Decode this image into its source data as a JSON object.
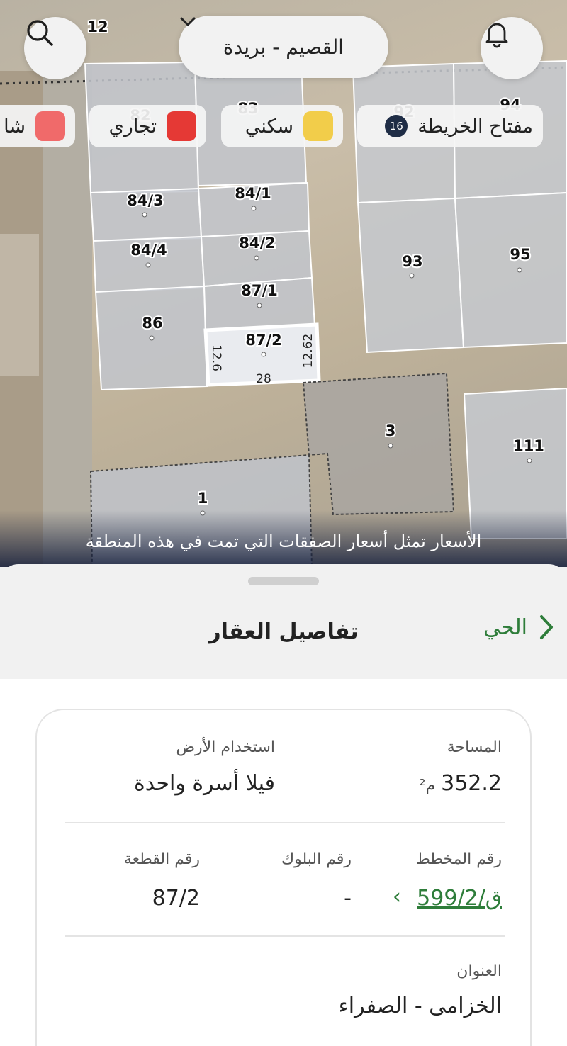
{
  "map": {
    "region": "القصيم - بريدة",
    "corner_number": "12",
    "legend": {
      "key_label": "مفتاح الخريطة",
      "key_badge": "16",
      "residential": "سكني",
      "commercial": "تجاري",
      "partial_label": "شا"
    },
    "colors": {
      "residential": "#f2cd4a",
      "commercial": "#e53935",
      "other": "#f06a6a",
      "accent": "#2e7d3a",
      "badge": "#1f2d46"
    },
    "plots": [
      "83",
      "82",
      "92",
      "94",
      "84/3",
      "84/1",
      "84/4",
      "84/2",
      "93",
      "95",
      "87/1",
      "86",
      "87/2",
      "3",
      "111",
      "1"
    ],
    "dimensions": {
      "side_left": "12.6",
      "side_right": "12.62",
      "bottom": "28"
    },
    "note": "الأسعار تمثل أسعار الصفقات التي تمت في هذه المنطقة"
  },
  "sheet": {
    "title": "تفاصيل العقار",
    "back_label": "الحي"
  },
  "details": {
    "area_label": "المساحة",
    "area_value": "352.2",
    "area_unit": "م²",
    "land_use_label": "استخدام الأرض",
    "land_use_value": "فيلا أسرة واحدة",
    "plan_label": "رقم المخطط",
    "plan_value": "ق/599/2",
    "block_label": "رقم البلوك",
    "block_value": "-",
    "plot_label": "رقم القطعة",
    "plot_value": "87/2",
    "address_label": "العنوان",
    "address_value": "الخزامى - الصفراء"
  }
}
